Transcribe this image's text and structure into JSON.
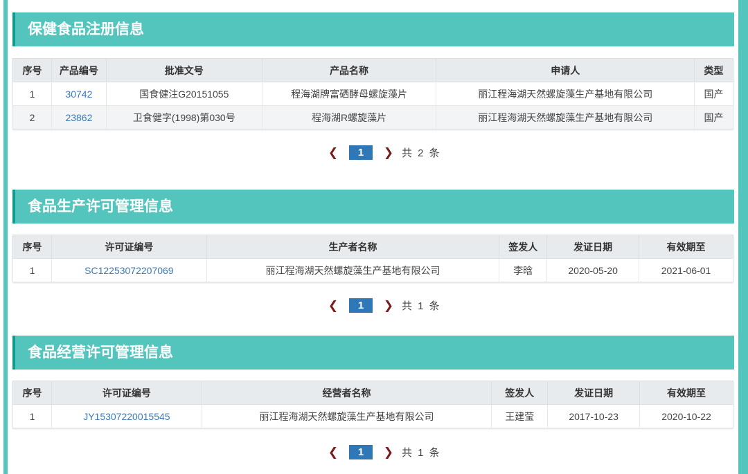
{
  "sections": [
    {
      "title": "保健食品注册信息",
      "headers": [
        "序号",
        "产品编号",
        "批准文号",
        "产品名称",
        "申请人",
        "类型"
      ],
      "rows": [
        [
          "1",
          "30742",
          "国食健注G20151055",
          "程海湖牌富硒酵母螺旋藻片",
          "丽江程海湖天然螺旋藻生产基地有限公司",
          "国产"
        ],
        [
          "2",
          "23862",
          "卫食健字(1998)第030号",
          "程海湖R螺旋藻片",
          "丽江程海湖天然螺旋藻生产基地有限公司",
          "国产"
        ]
      ],
      "pager": {
        "prev": "❮",
        "page": "1",
        "next": "❯",
        "total": "共 2 条"
      }
    },
    {
      "title": "食品生产许可管理信息",
      "headers": [
        "序号",
        "许可证编号",
        "生产者名称",
        "签发人",
        "发证日期",
        "有效期至"
      ],
      "rows": [
        [
          "1",
          "SC12253072207069",
          "丽江程海湖天然螺旋藻生产基地有限公司",
          "李晗",
          "2020-05-20",
          "2021-06-01"
        ]
      ],
      "pager": {
        "prev": "❮",
        "page": "1",
        "next": "❯",
        "total": "共 1 条"
      }
    },
    {
      "title": "食品经营许可管理信息",
      "headers": [
        "序号",
        "许可证编号",
        "经营者名称",
        "签发人",
        "发证日期",
        "有效期至"
      ],
      "rows": [
        [
          "1",
          "JY15307220015545",
          "丽江程海湖天然螺旋藻生产基地有限公司",
          "王建莹",
          "2017-10-23",
          "2020-10-22"
        ]
      ],
      "pager": {
        "prev": "❮",
        "page": "1",
        "next": "❯",
        "total": "共 1 条"
      }
    }
  ]
}
